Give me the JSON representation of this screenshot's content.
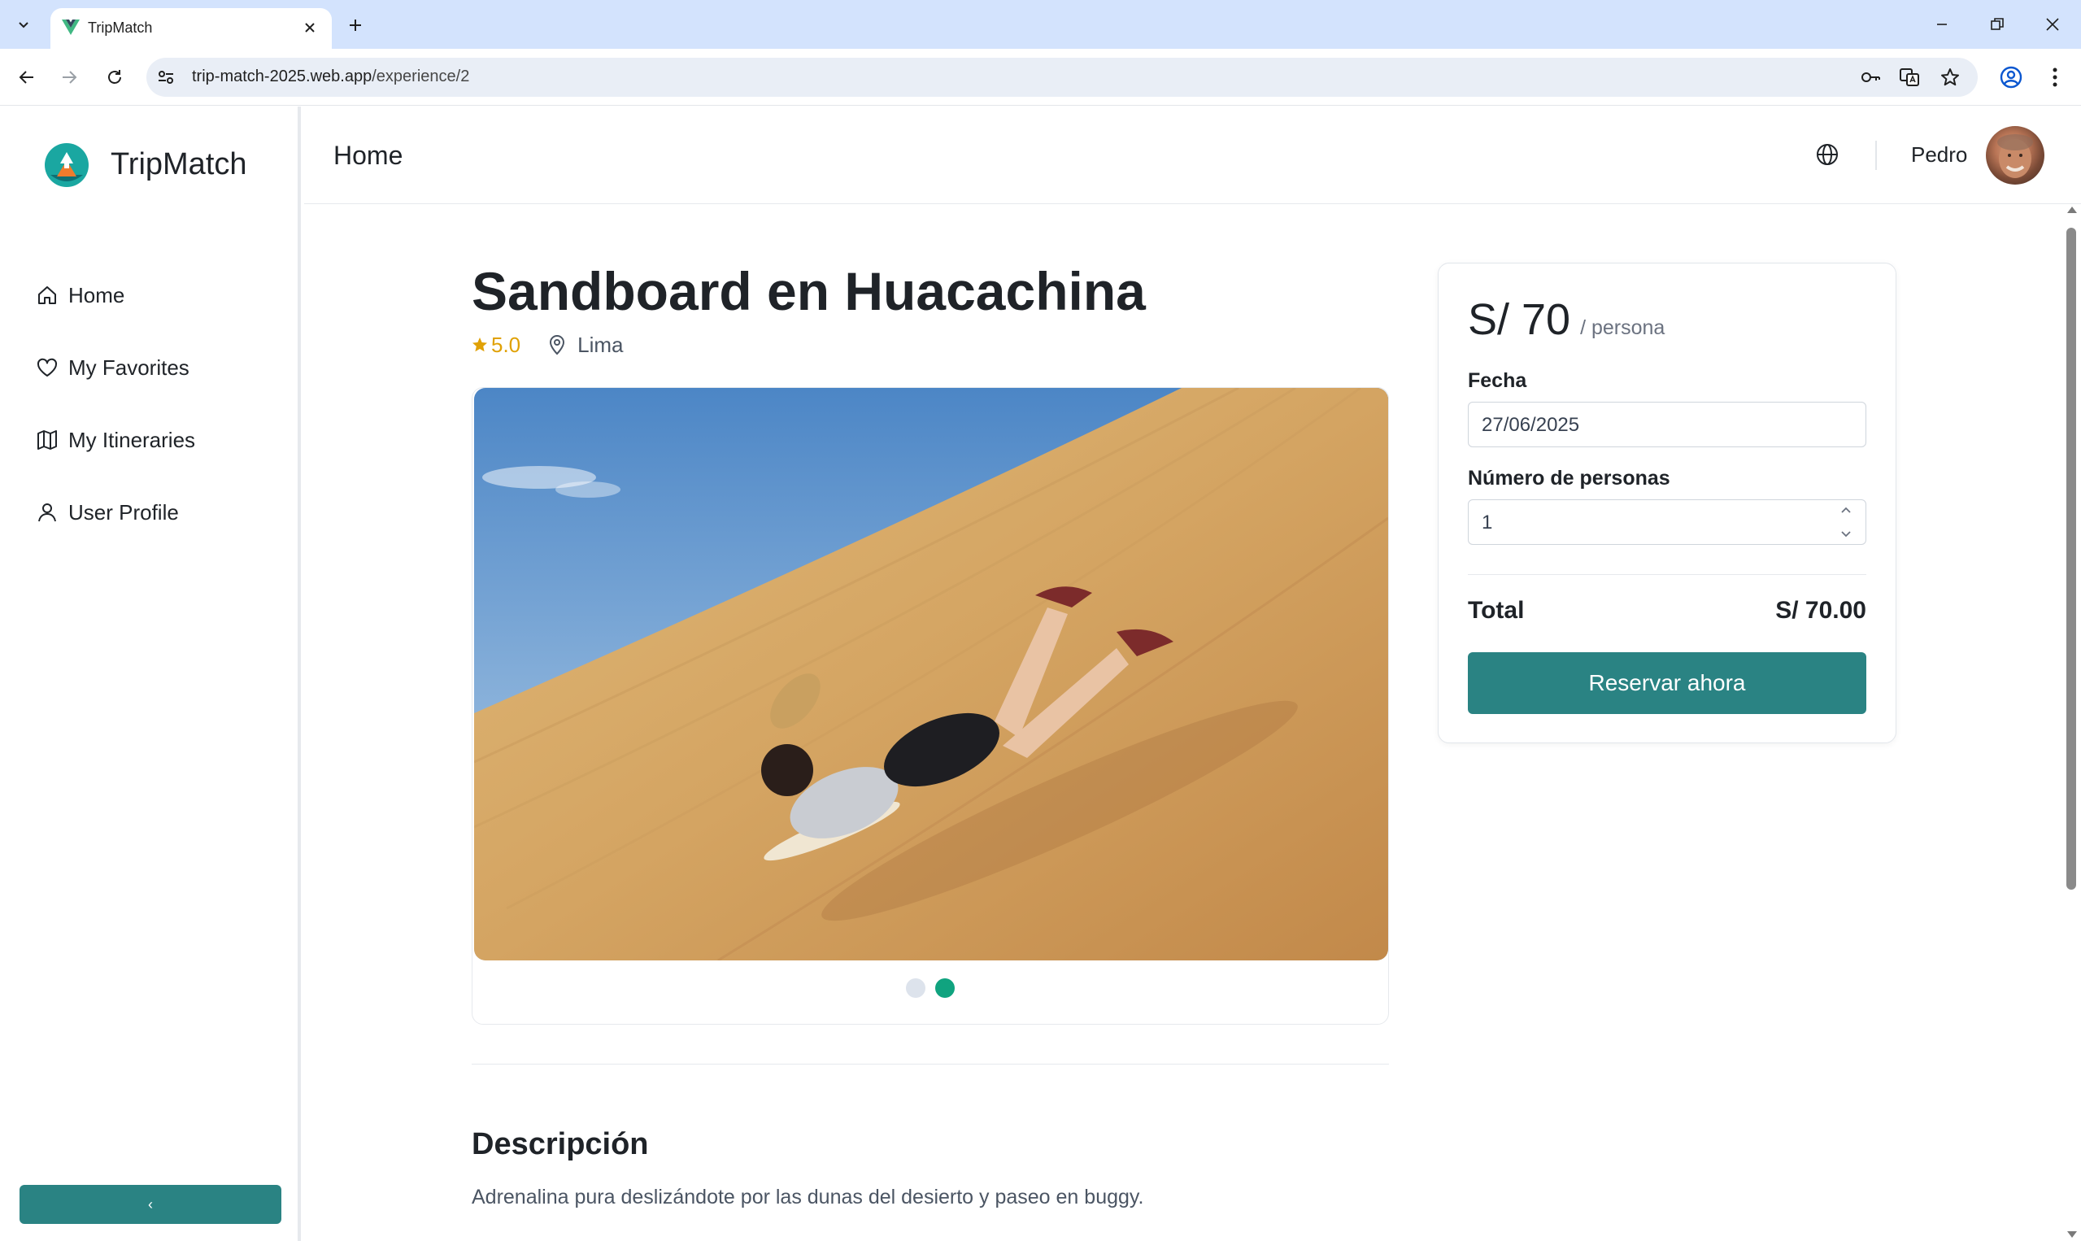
{
  "browser": {
    "tab_title": "TripMatch",
    "url_host": "trip-match-2025.web.app",
    "url_path": "/experience/2"
  },
  "sidebar": {
    "brand": "TripMatch",
    "items": [
      {
        "label": "Home",
        "icon": "home-icon"
      },
      {
        "label": "My Favorites",
        "icon": "heart-icon"
      },
      {
        "label": "My Itineraries",
        "icon": "map-icon"
      },
      {
        "label": "User Profile",
        "icon": "user-icon"
      }
    ],
    "collapse_label": "‹"
  },
  "header": {
    "title": "Home",
    "username": "Pedro"
  },
  "experience": {
    "title": "Sandboard en Huacachina",
    "rating": "5.0",
    "location": "Lima",
    "carousel": {
      "slides": 2,
      "active_slide": 2
    },
    "description_heading": "Descripción",
    "description": "Adrenalina pura deslizándote por las dunas del desierto y paseo en buggy."
  },
  "booking": {
    "price": "S/ 70",
    "price_unit": "/ persona",
    "date_label": "Fecha",
    "date_value": "27/06/2025",
    "people_label": "Número de personas",
    "people_value": "1",
    "total_label": "Total",
    "total_value": "S/ 70.00",
    "reserve_label": "Reservar ahora"
  },
  "colors": {
    "accent": "#2a8383",
    "active_dot": "#10a37f",
    "rating": "#e0a106",
    "tabstrip": "#d3e3fd"
  }
}
